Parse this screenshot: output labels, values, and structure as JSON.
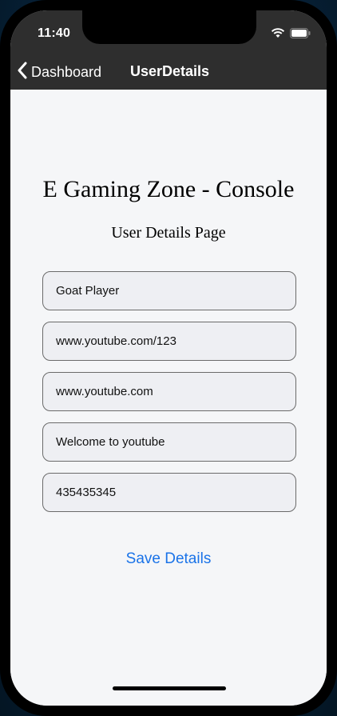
{
  "status_bar": {
    "time": "11:40",
    "icons": [
      "wifi-icon",
      "battery-icon"
    ]
  },
  "nav": {
    "back_label": "Dashboard",
    "back_icon": "chevron-left-icon",
    "title": "UserDetails"
  },
  "page": {
    "title": "E Gaming Zone - Console",
    "subtitle": "User Details Page"
  },
  "form": {
    "fields": [
      {
        "value": "Goat Player"
      },
      {
        "value": "www.youtube.com/123"
      },
      {
        "value": "www.youtube.com"
      },
      {
        "value": "Welcome to youtube"
      },
      {
        "value": "435435345"
      }
    ],
    "save_label": "Save Details"
  },
  "colors": {
    "bar_background": "#2e2e2e",
    "content_background": "#f5f6f8",
    "accent": "#1a73e8"
  }
}
